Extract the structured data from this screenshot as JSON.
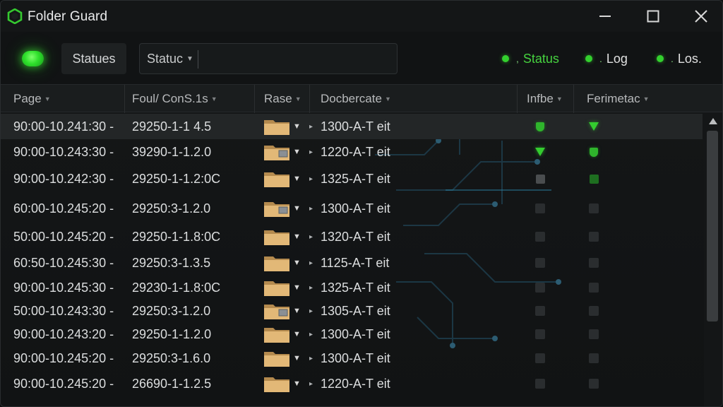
{
  "app": {
    "title": "Folder Guard",
    "window_controls": {
      "minimize": "—",
      "maximize": "☐",
      "close": "✕"
    }
  },
  "toolbar": {
    "power_state": "on",
    "statues_label": "Statues",
    "status_select_label": "Statuc",
    "search_value": "",
    "legend": [
      {
        "label": "Status",
        "color": "#46d23f"
      },
      {
        "label": "Log",
        "color": "#e0e0e0"
      },
      {
        "label": "Los.",
        "color": "#e0e0e0"
      }
    ]
  },
  "table": {
    "columns": [
      "Page",
      "Foul/ ConS.1s",
      "Rase",
      "Docbercate",
      "Infbe",
      "Ferimetac"
    ],
    "rows": [
      {
        "time": "90:00-10.241:30 -",
        "code": "29250-1-1 4.5",
        "doc": "1300-A-T eit",
        "infbe": "shield",
        "ferim": "triangle",
        "folder": "plain"
      },
      {
        "time": "90:00-10.243:30 -",
        "code": "39290-1-1.2.0",
        "doc": "1220-A-T eit",
        "infbe": "triangle",
        "ferim": "shield",
        "folder": "doc"
      },
      {
        "time": "90:00-10.242:30 -",
        "code": "29250-1-1.2:0C",
        "doc": "1325-A-T eit",
        "infbe": "grey",
        "ferim": "green-dim",
        "folder": "plain"
      },
      {
        "time": "60:00-10.245:20 -",
        "code": "29250:3-1.2.0",
        "doc": "1300-A-T eit",
        "infbe": "dark",
        "ferim": "dark",
        "folder": "doc"
      },
      {
        "time": "50:00-10.245:20 -",
        "code": "29250-1-1.8:0C",
        "doc": "1320-A-T eit",
        "infbe": "dark",
        "ferim": "dark",
        "folder": "plain"
      },
      {
        "time": "60:50-10.245:30 -",
        "code": "29250:3-1.3.5",
        "doc": "1125-A-T eit",
        "infbe": "dark",
        "ferim": "dark",
        "folder": "plain"
      },
      {
        "time": "90:00-10.245:30 -",
        "code": "29230-1-1.8:0C",
        "doc": "1325-A-T eit",
        "infbe": "dark",
        "ferim": "dark",
        "folder": "plain"
      },
      {
        "time": "50:00-10.243:30 -",
        "code": "29250:3-1.2.0",
        "doc": "1305-A-T eit",
        "infbe": "dark",
        "ferim": "dark",
        "folder": "doc"
      },
      {
        "time": "90:00-10.243:20 -",
        "code": "29250-1-1.2.0",
        "doc": "1300-A-T eit",
        "infbe": "dark",
        "ferim": "dark",
        "folder": "plain"
      },
      {
        "time": "90:00-10.245:20 -",
        "code": "29250:3-1.6.0",
        "doc": "1300-A-T eit",
        "infbe": "dark",
        "ferim": "dark",
        "folder": "plain"
      },
      {
        "time": "90:00-10.245:20 -",
        "code": "26690-1-1.2.5",
        "doc": "1220-A-T eit",
        "infbe": "dark",
        "ferim": "dark",
        "folder": "plain"
      }
    ]
  },
  "colors": {
    "accent": "#33d02e",
    "background": "#111314",
    "selected_row": "#232627"
  }
}
